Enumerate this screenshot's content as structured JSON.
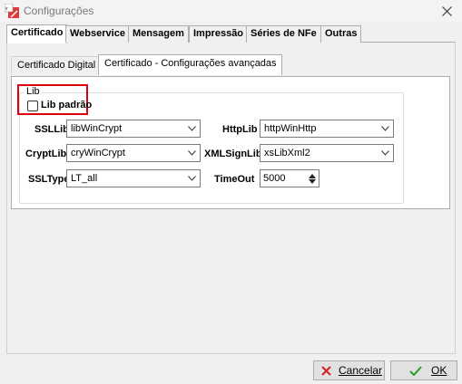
{
  "window": {
    "title": "Configurações",
    "app_icon": "nfe-app-icon",
    "close_icon": "close-icon"
  },
  "tabs": [
    "Certificado",
    "Webservice",
    "Mensagem",
    "Impressão",
    "Séries de NFe",
    "Outras"
  ],
  "active_tab": "Certificado",
  "subtabs": [
    "Certificado Digital",
    "Certificado - Configurações avançadas"
  ],
  "active_subtab": "Certificado - Configurações avançadas",
  "lib_group": {
    "title": "Lib",
    "lib_padrao": {
      "label": "Lib padrão",
      "checked": false
    }
  },
  "fields": {
    "ssllib": {
      "label": "SSLLib",
      "value": "libWinCrypt"
    },
    "cryptlib": {
      "label": "CryptLib",
      "value": "cryWinCrypt"
    },
    "ssltype": {
      "label": "SSLType",
      "value": "LT_all"
    },
    "httplib": {
      "label": "HttpLib",
      "value": "httpWinHttp"
    },
    "xmlsignlib": {
      "label": "XMLSignLib",
      "value": "xsLibXml2"
    },
    "timeout": {
      "label": "TimeOut",
      "value": "5000"
    }
  },
  "buttons": {
    "cancel": {
      "label": "Cancelar",
      "icon": "x-icon"
    },
    "ok": {
      "label": "OK",
      "icon": "check-icon"
    }
  },
  "colors": {
    "highlight": "#e0000a",
    "cancel_x": "#d42020",
    "ok_check": "#2f9b2f"
  }
}
